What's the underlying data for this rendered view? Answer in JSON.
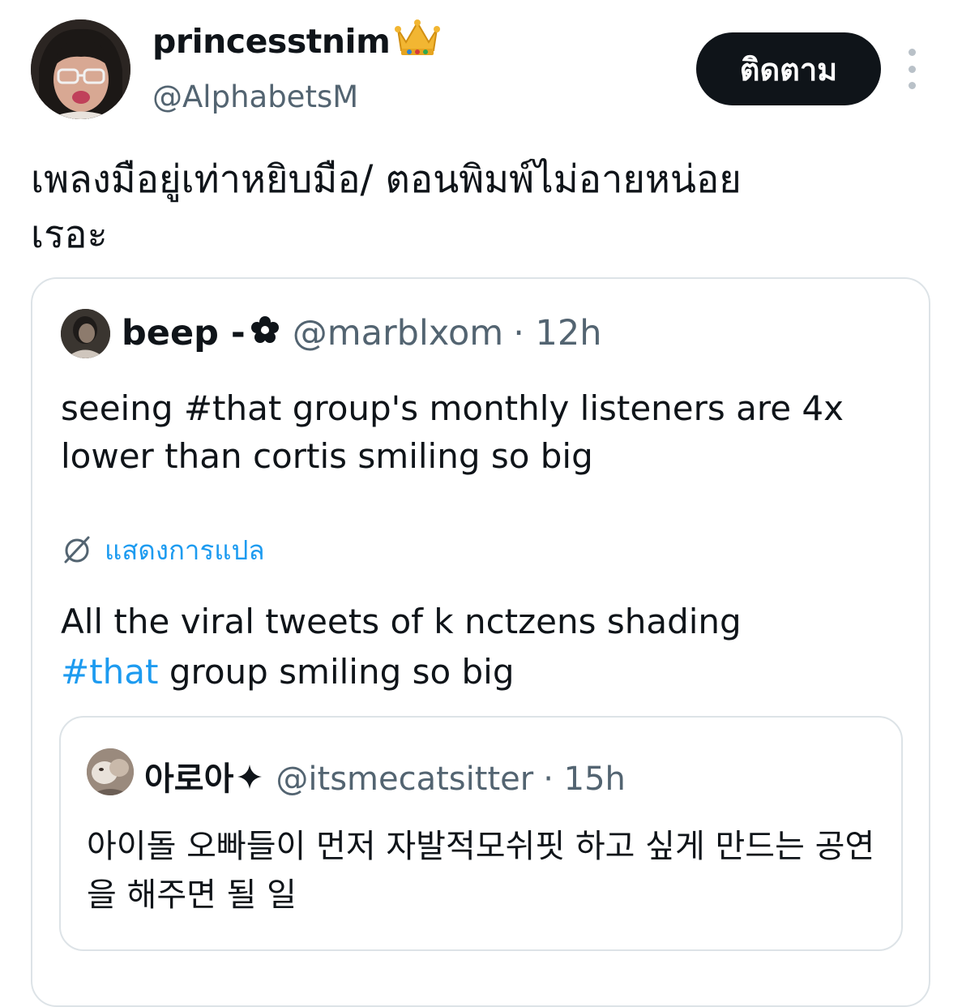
{
  "author": {
    "display_name": "princesstnim",
    "handle": "@AlphabetsM",
    "follow_label": "ติดตาม"
  },
  "tweet": {
    "text_line1": "เพลงมือยู่เท่าหยิบมือ/ ตอนพิมพ์ไม่อายหน่อย",
    "text_line2": "เรอะ"
  },
  "quoted": {
    "display_name": "beep -",
    "handle": "@marblxom",
    "time": "· 12h",
    "text": "seeing #that group's monthly listeners are 4x lower than cortis smiling so big",
    "translate_label": "แสดงการแปล",
    "translated_before": "All the viral tweets of k nctzens shading",
    "translated_hashtag": "#that",
    "translated_after": " group smiling so big"
  },
  "nested_quote": {
    "display_name": "아로아",
    "handle": "@itsmecatsitter",
    "time": "· 15h",
    "text": "아이돌 오빠들이 먼저 자발적모쉬핏 하고 싶게 만드는 공연을 해주면 될 일"
  },
  "colors": {
    "text": "#0f1419",
    "secondary": "#536471",
    "link": "#1d9bf0",
    "border": "#dde3e7",
    "button_bg": "#0f1419"
  },
  "icons": [
    "crown-icon",
    "more-icon",
    "flower-icon",
    "translate-icon",
    "sparkle-icon"
  ]
}
